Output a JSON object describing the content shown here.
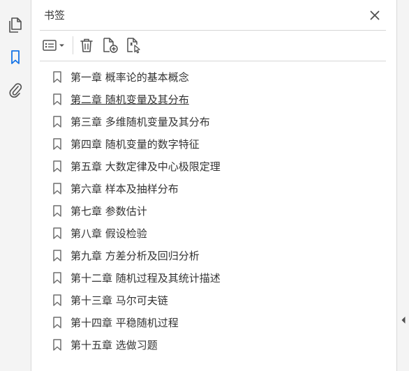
{
  "left_rail": {
    "items": [
      {
        "icon": "page-thumbnails-icon"
      },
      {
        "icon": "bookmark-icon",
        "active": true
      },
      {
        "icon": "attachment-icon"
      }
    ]
  },
  "panel": {
    "title": "书签",
    "toolbar": [
      {
        "icon": "options-menu-icon"
      },
      {
        "icon": "delete-icon"
      },
      {
        "icon": "new-bookmark-icon"
      },
      {
        "icon": "bookmark-from-structure-icon"
      }
    ]
  },
  "bookmarks": [
    {
      "label": "第一章  概率论的基本概念"
    },
    {
      "label": "第二章  随机变量及其分布",
      "underlined": true
    },
    {
      "label": "第三章  多维随机变量及其分布"
    },
    {
      "label": "第四章  随机变量的数字特征"
    },
    {
      "label": "第五章  大数定律及中心极限定理"
    },
    {
      "label": "第六章  样本及抽样分布"
    },
    {
      "label": "第七章  参数估计"
    },
    {
      "label": "第八章  假设检验"
    },
    {
      "label": "第九章  方差分析及回归分析"
    },
    {
      "label": "第十二章  随机过程及其统计描述"
    },
    {
      "label": "第十三章  马尔可夫链"
    },
    {
      "label": "第十四章  平稳随机过程"
    },
    {
      "label": "第十五章  选做习题"
    }
  ],
  "colors": {
    "accent": "#1473e6",
    "icon": "#505050",
    "text": "#333333"
  }
}
